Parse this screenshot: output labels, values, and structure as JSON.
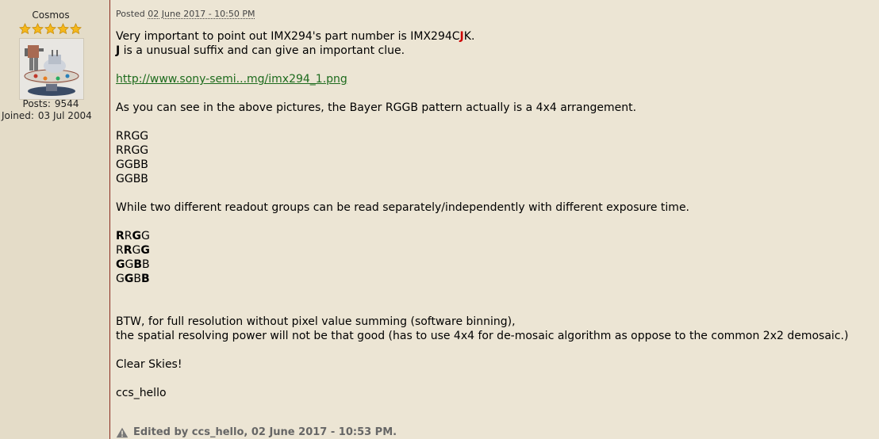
{
  "author": {
    "name": "Cosmos",
    "star_count": 5,
    "avatar_icon": "robot-figurine-avatar",
    "posts_label": "Posts:",
    "posts_value": "9544",
    "joined_label": "Joined:",
    "joined_value": "03 Jul 2004"
  },
  "post": {
    "posted_label": "Posted",
    "posted_date": "02 June 2017 - 10:50 PM",
    "line1_prefix": "Very important to point out IMX294's part number is IMX294C",
    "line1_highlight": "J",
    "line1_suffix": "K.",
    "line2_bold": "J",
    "line2_rest": " is a unusual suffix and can give an important clue.",
    "link_text": "http://www.sony-semi...mg/imx294_1.png",
    "para_bayer": "As you can see in the above pictures, the Bayer RGGB pattern actually is a 4x4 arrangement.",
    "grid_rows": [
      "RRGG",
      "RRGG",
      "GGBB",
      "GGBB"
    ],
    "para_readout": "While two different readout groups can be read separately/independently with different exposure time.",
    "bold_grid": [
      [
        {
          "t": "R",
          "b": true
        },
        {
          "t": "R",
          "b": false
        },
        {
          "t": "G",
          "b": true
        },
        {
          "t": "G",
          "b": false
        }
      ],
      [
        {
          "t": "R",
          "b": false
        },
        {
          "t": "R",
          "b": true
        },
        {
          "t": "G",
          "b": false
        },
        {
          "t": "G",
          "b": true
        }
      ],
      [
        {
          "t": "G",
          "b": true
        },
        {
          "t": "G",
          "b": false
        },
        {
          "t": "B",
          "b": true
        },
        {
          "t": "B",
          "b": false
        }
      ],
      [
        {
          "t": "G",
          "b": false
        },
        {
          "t": "G",
          "b": true
        },
        {
          "t": "B",
          "b": false
        },
        {
          "t": "B",
          "b": true
        }
      ]
    ],
    "btw_line1": "BTW, for full resolution without pixel value summing (software binning),",
    "btw_line2": "the spatial resolving power will not be that good (has to use 4x4 for de-mosaic algorithm as oppose to the common 2x2 demosaic.)",
    "signoff": "Clear Skies!",
    "signature": "ccs_hello",
    "edited_icon": "warning-icon",
    "edited_text": "Edited by ccs_hello, 02 June 2017 - 10:53 PM."
  },
  "colors": {
    "post_bg": "#ece5d4",
    "sidebar_bg": "#e4dcc8",
    "divider": "#8a2a1e",
    "highlight_red": "#cc0000",
    "link_green": "#1d6b1d"
  }
}
